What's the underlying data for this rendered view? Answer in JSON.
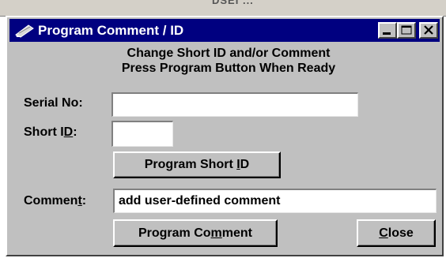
{
  "background_window": {
    "title_fragment": "DSEI ..."
  },
  "window": {
    "title": "Program Comment / ID",
    "icon": "pencil-icon",
    "controls": {
      "minimize": "minimize-icon",
      "maximize": "maximize-icon",
      "close": "close-icon"
    }
  },
  "instructions": {
    "line1": "Change Short ID and/or Comment",
    "line2": "Press Program Button When Ready"
  },
  "serial": {
    "label": "Serial No:",
    "value": ""
  },
  "short_id": {
    "label_pre": "Short I",
    "label_mnemonic": "D",
    "label_post": ":",
    "value": ""
  },
  "program_short_id_button": {
    "pre": "Program Short ",
    "mnemonic": "I",
    "post": "D"
  },
  "comment": {
    "label_pre": "Commen",
    "label_mnemonic": "t",
    "label_post": ":",
    "value": "add user-defined comment"
  },
  "program_comment_button": {
    "pre": "Program Co",
    "mnemonic": "m",
    "post": "ment"
  },
  "close_button": {
    "pre": "",
    "mnemonic": "C",
    "post": "lose"
  },
  "colors": {
    "titlebar": "#000080",
    "face": "#c0c0c0",
    "field": "#ffffff"
  }
}
